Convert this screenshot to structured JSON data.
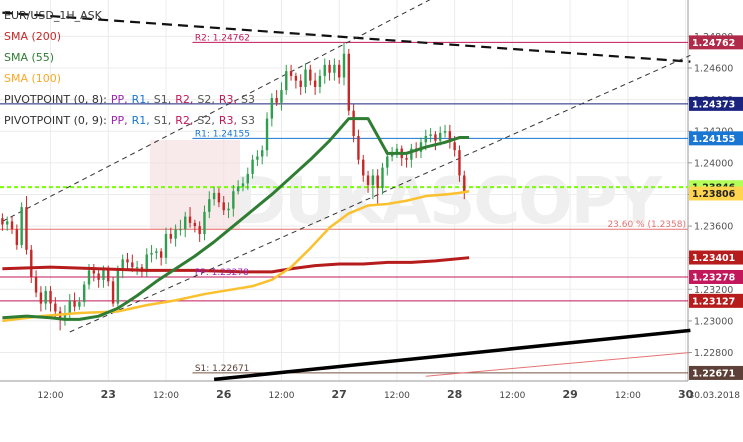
{
  "chart_data": {
    "type": "candlestick",
    "symbol_title": "EUR/USD_1H_ASK",
    "watermark": "DUKASCOPY",
    "ylim": [
      1.2262,
      1.2503
    ],
    "xlim": [
      0,
      143
    ],
    "x_ticks": [
      {
        "x": 10,
        "label": "12:00"
      },
      {
        "x": 22,
        "label": "23"
      },
      {
        "x": 34,
        "label": "12:00"
      },
      {
        "x": 46,
        "label": "26"
      },
      {
        "x": 58,
        "label": "12:00"
      },
      {
        "x": 70,
        "label": "27"
      },
      {
        "x": 82,
        "label": "12:00"
      },
      {
        "x": 94,
        "label": "28"
      },
      {
        "x": 106,
        "label": "12:00"
      },
      {
        "x": 118,
        "label": "29"
      },
      {
        "x": 130,
        "label": "12:00"
      },
      {
        "x": 142,
        "label": "30"
      }
    ],
    "date_label": "30.03.2018",
    "y_ticks": [
      {
        "v": 1.248,
        "label": "1.24800"
      },
      {
        "v": 1.246,
        "label": "1.24600"
      },
      {
        "v": 1.244,
        "label": "1.24400"
      },
      {
        "v": 1.242,
        "label": "1.24200"
      },
      {
        "v": 1.24,
        "label": "1.24000"
      },
      {
        "v": 1.238,
        "label": "1.23800"
      },
      {
        "v": 1.236,
        "label": "1.23600"
      },
      {
        "v": 1.234,
        "label": "1.23400"
      },
      {
        "v": 1.232,
        "label": "1.23200"
      },
      {
        "v": 1.23,
        "label": "1.23000"
      },
      {
        "v": 1.228,
        "label": "1.22800"
      }
    ],
    "price_tags": [
      {
        "v": 1.24762,
        "label": "1.24762",
        "color": "#b02a4a"
      },
      {
        "v": 1.24373,
        "label": "1.24373",
        "color": "#1a237e"
      },
      {
        "v": 1.24155,
        "label": "1.24155",
        "color": "#1976d2"
      },
      {
        "v": 1.23846,
        "label": "1.23846",
        "color": "#b2ff59"
      },
      {
        "v": 1.23806,
        "label": "1.23806",
        "color": "#ffd54f"
      },
      {
        "v": 1.23401,
        "label": "1.23401",
        "color": "#b71c1c"
      },
      {
        "v": 1.23278,
        "label": "1.23278",
        "color": "#c2185b"
      },
      {
        "v": 1.23127,
        "label": "1.23127",
        "color": "#b71c1c"
      },
      {
        "v": 1.22671,
        "label": "1.22671",
        "color": "#5d4037"
      }
    ],
    "indicators": [
      {
        "name": "SMA (200)",
        "color": "#c62828"
      },
      {
        "name": "SMA (55)",
        "color": "#2e7d32"
      },
      {
        "name": "SMA (100)",
        "color": "#f9a825"
      }
    ],
    "pivot_legends": [
      {
        "prefix": "PIVOTPOINT (0, 8):",
        "items": [
          {
            "t": "PP",
            "c": "#9c27b0"
          },
          {
            "t": "R1",
            "c": "#1976d2"
          },
          {
            "t": "S1",
            "c": "#555555"
          },
          {
            "t": "R2",
            "c": "#c2185b"
          },
          {
            "t": "S2",
            "c": "#555555"
          },
          {
            "t": "R3",
            "c": "#c2185b"
          },
          {
            "t": "S3",
            "c": "#555555"
          }
        ]
      },
      {
        "prefix": "PIVOTPOINT (0, 9):",
        "items": [
          {
            "t": "PP",
            "c": "#9c27b0"
          },
          {
            "t": "R1",
            "c": "#1976d2"
          },
          {
            "t": "S1",
            "c": "#555555"
          },
          {
            "t": "R2",
            "c": "#c2185b"
          },
          {
            "t": "S2",
            "c": "#555555"
          },
          {
            "t": "R3",
            "c": "#c2185b"
          },
          {
            "t": "S3",
            "c": "#555555"
          }
        ]
      }
    ],
    "pivot_labels": [
      {
        "label": "R2: 1.24762",
        "v": 1.24762,
        "x": 40,
        "color": "#c2185b"
      },
      {
        "label": "R1: 1.24155",
        "v": 1.24155,
        "x": 40,
        "color": "#1976d2"
      },
      {
        "label": "PP: 1.23278",
        "v": 1.23278,
        "x": 40,
        "color": "#9c27b0"
      },
      {
        "label": "S1: 1.22671",
        "v": 1.22671,
        "x": 40,
        "color": "#5d4037"
      }
    ],
    "fib_label": {
      "label": "23.60 % (1.2358)",
      "v": 1.2358,
      "color": "#e57373"
    },
    "h_lines": [
      {
        "v": 1.24762,
        "x0": 39.5,
        "color": "#c2185b",
        "width": 1,
        "dash": ""
      },
      {
        "v": 1.24373,
        "x0": 0,
        "color": "#1a237e",
        "width": 1,
        "dash": ""
      },
      {
        "v": 1.24155,
        "x0": 39.5,
        "color": "#1976d2",
        "width": 1,
        "dash": ""
      },
      {
        "v": 1.23846,
        "x0": 0,
        "color": "#76ff03",
        "width": 2,
        "dash": "4,3"
      },
      {
        "v": 1.2358,
        "x0": 0,
        "color": "#e57373",
        "width": 1,
        "dash": ""
      },
      {
        "v": 1.23278,
        "x0": 0,
        "color": "#c2185b",
        "width": 1,
        "dash": ""
      },
      {
        "v": 1.23127,
        "x0": 0,
        "color": "#c2185b",
        "width": 1,
        "dash": ""
      },
      {
        "v": 1.22671,
        "x0": 39.5,
        "color": "#795548",
        "width": 1,
        "dash": ""
      }
    ],
    "trend_lines": [
      {
        "x1": 0,
        "y1": 1.2495,
        "x2": 143,
        "y2": 1.2464,
        "color": "#111111",
        "width": 2.2,
        "dash": "10,6"
      },
      {
        "x1": 0,
        "y1": 1.2363,
        "x2": 90,
        "y2": 1.2505,
        "color": "#333333",
        "width": 1,
        "dash": "5,4"
      },
      {
        "x1": 14,
        "y1": 1.2293,
        "x2": 143,
        "y2": 1.2468,
        "color": "#333333",
        "width": 1,
        "dash": "5,4"
      },
      {
        "x1": 44,
        "y1": 1.2263,
        "x2": 143,
        "y2": 1.2294,
        "color": "#000000",
        "width": 3.5,
        "dash": ""
      },
      {
        "x1": 88,
        "y1": 1.2265,
        "x2": 143,
        "y2": 1.228,
        "color": "#e57373",
        "width": 1,
        "dash": ""
      }
    ],
    "sma_200": [
      [
        0,
        1.2333
      ],
      [
        10,
        1.2334
      ],
      [
        20,
        1.2333
      ],
      [
        30,
        1.2332
      ],
      [
        40,
        1.2332
      ],
      [
        50,
        1.2331
      ],
      [
        56,
        1.2331
      ],
      [
        60,
        1.2333
      ],
      [
        65,
        1.2335
      ],
      [
        70,
        1.2336
      ],
      [
        75,
        1.2336
      ],
      [
        80,
        1.2337
      ],
      [
        85,
        1.2337
      ],
      [
        90,
        1.2338
      ],
      [
        97,
        1.234
      ]
    ],
    "sma_55": [
      [
        0,
        1.2302
      ],
      [
        5,
        1.2303
      ],
      [
        10,
        1.2302
      ],
      [
        13,
        1.2301
      ],
      [
        16,
        1.2301
      ],
      [
        20,
        1.2303
      ],
      [
        24,
        1.2308
      ],
      [
        28,
        1.2316
      ],
      [
        32,
        1.2325
      ],
      [
        36,
        1.2333
      ],
      [
        40,
        1.2341
      ],
      [
        44,
        1.235
      ],
      [
        48,
        1.236
      ],
      [
        52,
        1.237
      ],
      [
        56,
        1.238
      ],
      [
        60,
        1.2391
      ],
      [
        64,
        1.2402
      ],
      [
        68,
        1.2414
      ],
      [
        72,
        1.2428
      ],
      [
        76,
        1.2428
      ],
      [
        80,
        1.2406
      ],
      [
        84,
        1.2406
      ],
      [
        88,
        1.241
      ],
      [
        92,
        1.2413
      ],
      [
        95,
        1.2416
      ],
      [
        97,
        1.2416
      ]
    ],
    "sma_100": [
      [
        0,
        1.23
      ],
      [
        8,
        1.2303
      ],
      [
        16,
        1.2305
      ],
      [
        24,
        1.2306
      ],
      [
        30,
        1.231
      ],
      [
        36,
        1.2313
      ],
      [
        42,
        1.2317
      ],
      [
        48,
        1.232
      ],
      [
        52,
        1.2322
      ],
      [
        56,
        1.2326
      ],
      [
        60,
        1.2334
      ],
      [
        64,
        1.2346
      ],
      [
        68,
        1.2359
      ],
      [
        72,
        1.2368
      ],
      [
        76,
        1.2373
      ],
      [
        80,
        1.2374
      ],
      [
        84,
        1.2376
      ],
      [
        88,
        1.2379
      ],
      [
        92,
        1.238
      ],
      [
        95,
        1.2381
      ],
      [
        97,
        1.2382
      ]
    ],
    "candles": [
      [
        1.2365,
        1.2361,
        1.2368,
        1.2357
      ],
      [
        1.2361,
        1.2363,
        1.2366,
        1.2357
      ],
      [
        1.2363,
        1.2358,
        1.2366,
        1.2355
      ],
      [
        1.2358,
        1.2348,
        1.2361,
        1.2345
      ],
      [
        1.2348,
        1.2372,
        1.2375,
        1.2346
      ],
      [
        1.2372,
        1.2345,
        1.2379,
        1.2342
      ],
      [
        1.2345,
        1.2328,
        1.2348,
        1.2324
      ],
      [
        1.2328,
        1.2318,
        1.2332,
        1.2315
      ],
      [
        1.2318,
        1.2311,
        1.2322,
        1.2306
      ],
      [
        1.2311,
        1.2319,
        1.2322,
        1.2307
      ],
      [
        1.2319,
        1.2311,
        1.2322,
        1.2306
      ],
      [
        1.2311,
        1.2306,
        1.2315,
        1.2301
      ],
      [
        1.2306,
        1.2302,
        1.2309,
        1.2294
      ],
      [
        1.2302,
        1.2305,
        1.231,
        1.2297
      ],
      [
        1.2305,
        1.2313,
        1.2317,
        1.2301
      ],
      [
        1.2313,
        1.2309,
        1.2318,
        1.2306
      ],
      [
        1.2309,
        1.2312,
        1.2315,
        1.2307
      ],
      [
        1.2312,
        1.2323,
        1.2325,
        1.2309
      ],
      [
        1.2323,
        1.2332,
        1.2336,
        1.232
      ],
      [
        1.2332,
        1.233,
        1.2336,
        1.2325
      ],
      [
        1.233,
        1.2326,
        1.2333,
        1.2321
      ],
      [
        1.2326,
        1.2332,
        1.2335,
        1.2321
      ],
      [
        1.2332,
        1.2325,
        1.2335,
        1.2322
      ],
      [
        1.2325,
        1.2311,
        1.2328,
        1.2309
      ],
      [
        1.2311,
        1.2332,
        1.2335,
        1.2309
      ],
      [
        1.2332,
        1.2339,
        1.2342,
        1.2327
      ],
      [
        1.2339,
        1.2337,
        1.2343,
        1.2332
      ],
      [
        1.2337,
        1.2334,
        1.2342,
        1.2331
      ],
      [
        1.2334,
        1.2334,
        1.2338,
        1.2329
      ],
      [
        1.2334,
        1.2331,
        1.2336,
        1.2328
      ],
      [
        1.2331,
        1.2342,
        1.2346,
        1.2328
      ],
      [
        1.2342,
        1.2343,
        1.2348,
        1.2337
      ],
      [
        1.2343,
        1.2344,
        1.2346,
        1.2339
      ],
      [
        1.2344,
        1.234,
        1.2346,
        1.2335
      ],
      [
        1.234,
        1.2355,
        1.2359,
        1.2336
      ],
      [
        1.2355,
        1.2352,
        1.2359,
        1.2349
      ],
      [
        1.2352,
        1.2358,
        1.2361,
        1.2347
      ],
      [
        1.2358,
        1.2358,
        1.2364,
        1.2354
      ],
      [
        1.2358,
        1.2366,
        1.2369,
        1.2353
      ],
      [
        1.2366,
        1.2362,
        1.2372,
        1.2359
      ],
      [
        1.2362,
        1.236,
        1.2364,
        1.2356
      ],
      [
        1.236,
        1.2355,
        1.2363,
        1.235
      ],
      [
        1.2355,
        1.2369,
        1.2373,
        1.2351
      ],
      [
        1.2369,
        1.2377,
        1.2382,
        1.2365
      ],
      [
        1.2377,
        1.2381,
        1.2385,
        1.2373
      ],
      [
        1.2381,
        1.2375,
        1.2384,
        1.2372
      ],
      [
        1.2375,
        1.237,
        1.2379,
        1.2367
      ],
      [
        1.237,
        1.2371,
        1.2375,
        1.2365
      ],
      [
        1.2371,
        1.2382,
        1.2386,
        1.2366
      ],
      [
        1.2382,
        1.2385,
        1.2389,
        1.238
      ],
      [
        1.2385,
        1.2387,
        1.2391,
        1.2382
      ],
      [
        1.2387,
        1.2393,
        1.2397,
        1.2383
      ],
      [
        1.2393,
        1.2402,
        1.2405,
        1.239
      ],
      [
        1.2402,
        1.2404,
        1.2408,
        1.2398
      ],
      [
        1.2404,
        1.2408,
        1.2411,
        1.2399
      ],
      [
        1.2408,
        1.2428,
        1.2432,
        1.2404
      ],
      [
        1.2428,
        1.2441,
        1.2444,
        1.2423
      ],
      [
        1.2441,
        1.2438,
        1.2446,
        1.2436
      ],
      [
        1.2438,
        1.2446,
        1.2451,
        1.2433
      ],
      [
        1.2446,
        1.2458,
        1.2462,
        1.2443
      ],
      [
        1.2458,
        1.2455,
        1.2462,
        1.2452
      ],
      [
        1.2455,
        1.2452,
        1.2457,
        1.2447
      ],
      [
        1.2452,
        1.2448,
        1.2456,
        1.2443
      ],
      [
        1.2448,
        1.2459,
        1.2463,
        1.2444
      ],
      [
        1.2459,
        1.2452,
        1.2462,
        1.2449
      ],
      [
        1.2452,
        1.2448,
        1.2457,
        1.2443
      ],
      [
        1.2448,
        1.2455,
        1.2459,
        1.2444
      ],
      [
        1.2455,
        1.2462,
        1.2466,
        1.245
      ],
      [
        1.2462,
        1.2457,
        1.2465,
        1.2452
      ],
      [
        1.2457,
        1.2462,
        1.2466,
        1.2452
      ],
      [
        1.2462,
        1.2454,
        1.2465,
        1.245
      ],
      [
        1.2454,
        1.2469,
        1.2476,
        1.2449
      ],
      [
        1.2469,
        1.2433,
        1.2472,
        1.243
      ],
      [
        1.2433,
        1.2417,
        1.2437,
        1.2413
      ],
      [
        1.2417,
        1.2402,
        1.2421,
        1.2399
      ],
      [
        1.2402,
        1.2392,
        1.2405,
        1.2388
      ],
      [
        1.2392,
        1.2386,
        1.2395,
        1.2381
      ],
      [
        1.2386,
        1.2392,
        1.2396,
        1.2377
      ],
      [
        1.2392,
        1.2384,
        1.2396,
        1.2373
      ],
      [
        1.2384,
        1.2397,
        1.24,
        1.238
      ],
      [
        1.2397,
        1.2404,
        1.2408,
        1.2392
      ],
      [
        1.2404,
        1.2406,
        1.241,
        1.2401
      ],
      [
        1.2406,
        1.2409,
        1.2412,
        1.2403
      ],
      [
        1.2409,
        1.2403,
        1.2411,
        1.2398
      ],
      [
        1.2403,
        1.2402,
        1.2407,
        1.2397
      ],
      [
        1.2402,
        1.2409,
        1.2412,
        1.2397
      ],
      [
        1.2409,
        1.2407,
        1.2413,
        1.2403
      ],
      [
        1.2407,
        1.2413,
        1.2416,
        1.2403
      ],
      [
        1.2413,
        1.2417,
        1.2421,
        1.2408
      ],
      [
        1.2417,
        1.2418,
        1.2422,
        1.2413
      ],
      [
        1.2418,
        1.2414,
        1.242,
        1.2408
      ],
      [
        1.2414,
        1.2419,
        1.2423,
        1.2411
      ],
      [
        1.2419,
        1.242,
        1.2424,
        1.2416
      ],
      [
        1.242,
        1.2413,
        1.2424,
        1.2409
      ],
      [
        1.2413,
        1.2408,
        1.2417,
        1.2404
      ],
      [
        1.2408,
        1.2392,
        1.2411,
        1.2388
      ],
      [
        1.2392,
        1.2381,
        1.2395,
        1.2377
      ]
    ]
  }
}
